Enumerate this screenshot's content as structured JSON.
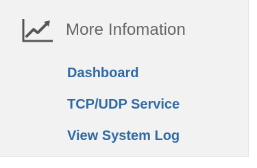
{
  "section": {
    "title": "More Infomation",
    "icon": "line-chart-icon",
    "links": [
      {
        "label": "Dashboard"
      },
      {
        "label": "TCP/UDP Service"
      },
      {
        "label": "View System Log"
      }
    ]
  },
  "colors": {
    "panel_bg": "#f2f2f2",
    "title": "#676767",
    "link": "#2f6aa5",
    "icon": "#555555"
  }
}
